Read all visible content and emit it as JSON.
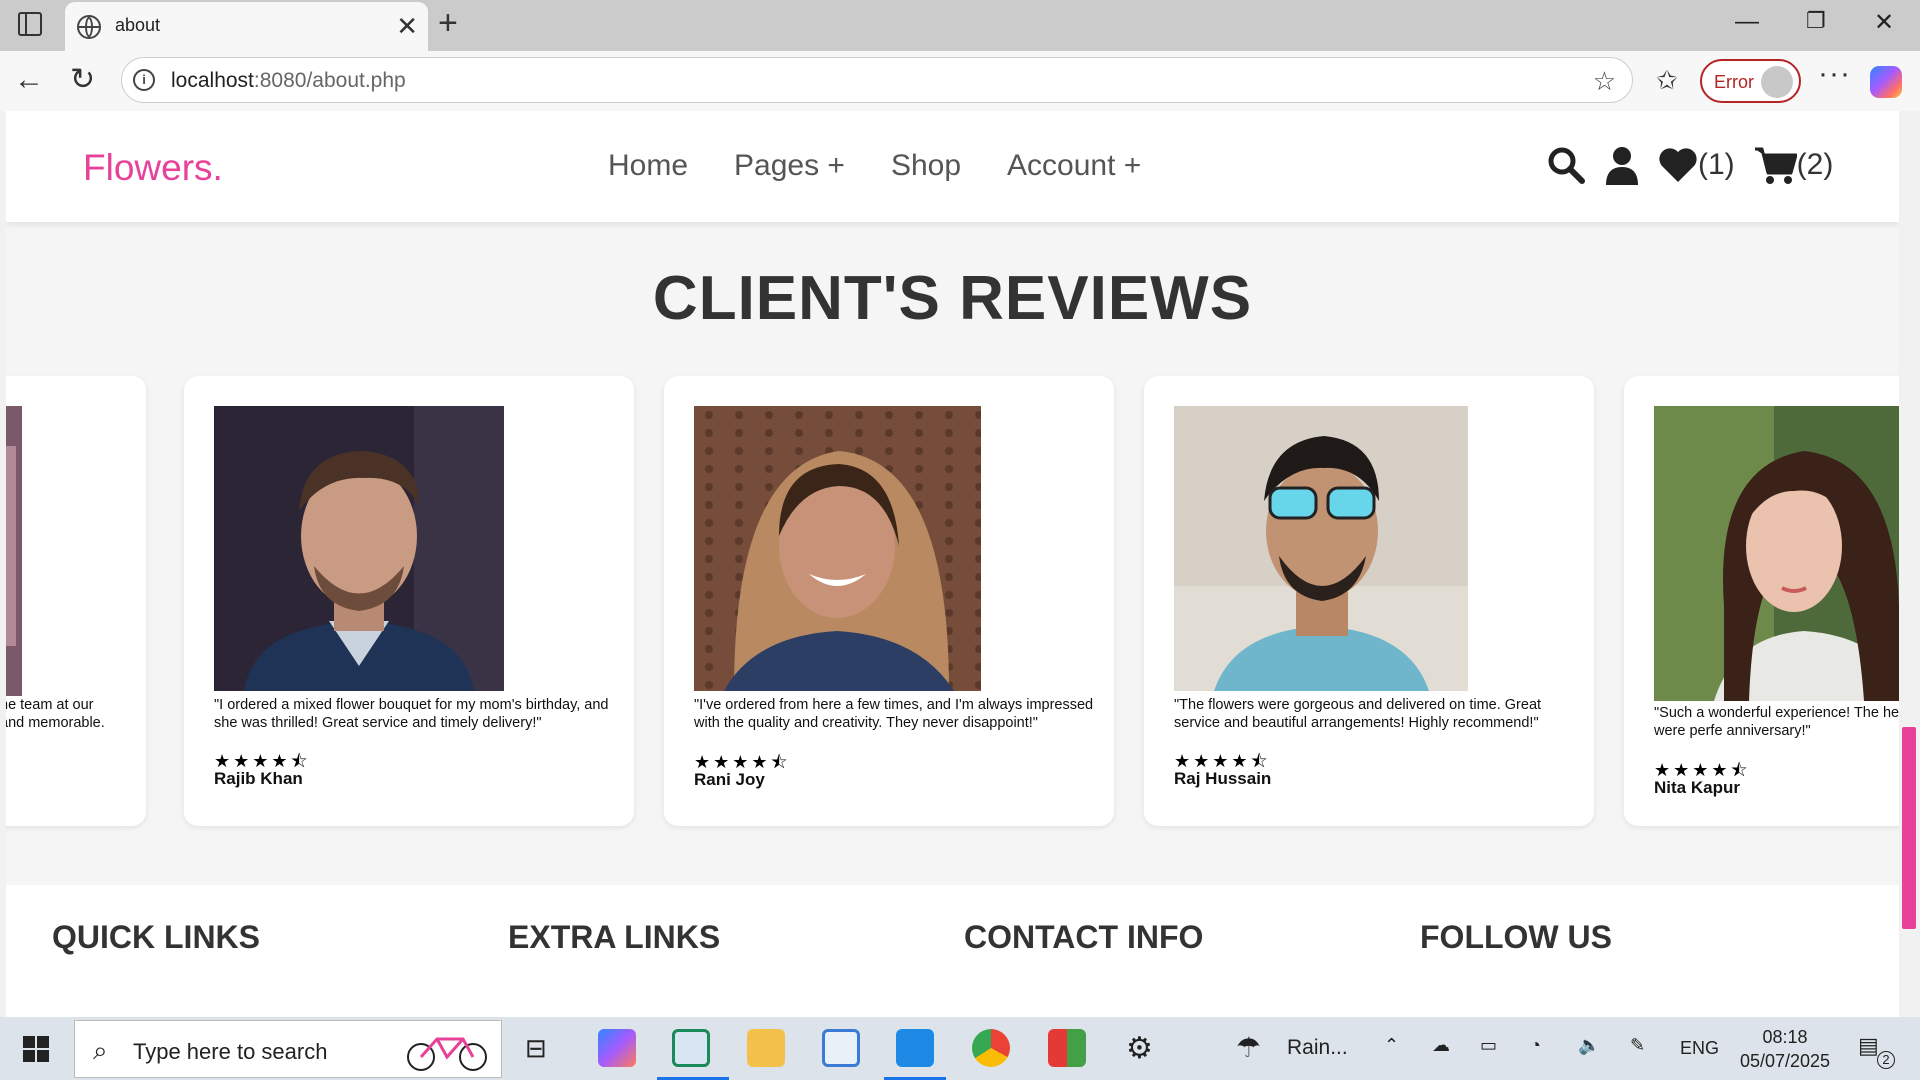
{
  "browser": {
    "tab_title": "about",
    "url_host": "localhost",
    "url_rest": ":8080/about.php",
    "error_label": "Error"
  },
  "site": {
    "logo": "Flowers.",
    "nav": [
      "Home",
      "Pages +",
      "Shop",
      "Account +"
    ],
    "wishlist_count": "(1)",
    "cart_count": "(2)"
  },
  "reviews": {
    "title": "CLIENT'S REVIEWS",
    "partial_left": {
      "quote_line1": "he team at our",
      "quote_line2": "and memorable."
    },
    "cards": [
      {
        "quote": "\"I ordered a mixed flower bouquet for my mom's birthday, and she was thrilled! Great service and timely delivery!\"",
        "rating": 4.5,
        "name": "Rajib Khan"
      },
      {
        "quote": "\"I've ordered from here a few times, and I'm always impressed with the quality and creativity. They never disappoint!\"",
        "rating": 4.5,
        "name": "Rani Joy"
      },
      {
        "quote": "\"The flowers were gorgeous and delivered on time. Great service and beautiful arrangements! Highly recommend!\"",
        "rating": 4.5,
        "name": "Raj Hussain"
      },
      {
        "quote": "\"Such a wonderful experience! The helpful, and the flowers were perfe anniversary!\"",
        "rating": 4.5,
        "name": "Nita Kapur"
      }
    ]
  },
  "footer": {
    "headings": [
      "QUICK LINKS",
      "EXTRA LINKS",
      "CONTACT INFO",
      "FOLLOW US"
    ]
  },
  "taskbar": {
    "search_placeholder": "Type here to search",
    "weather": "Rain...",
    "language": "ENG",
    "time": "08:18",
    "date": "05/07/2025",
    "notifications": "2"
  },
  "colors": {
    "brand": "#e8419a",
    "text_dark": "#333333",
    "error": "#b32424"
  }
}
